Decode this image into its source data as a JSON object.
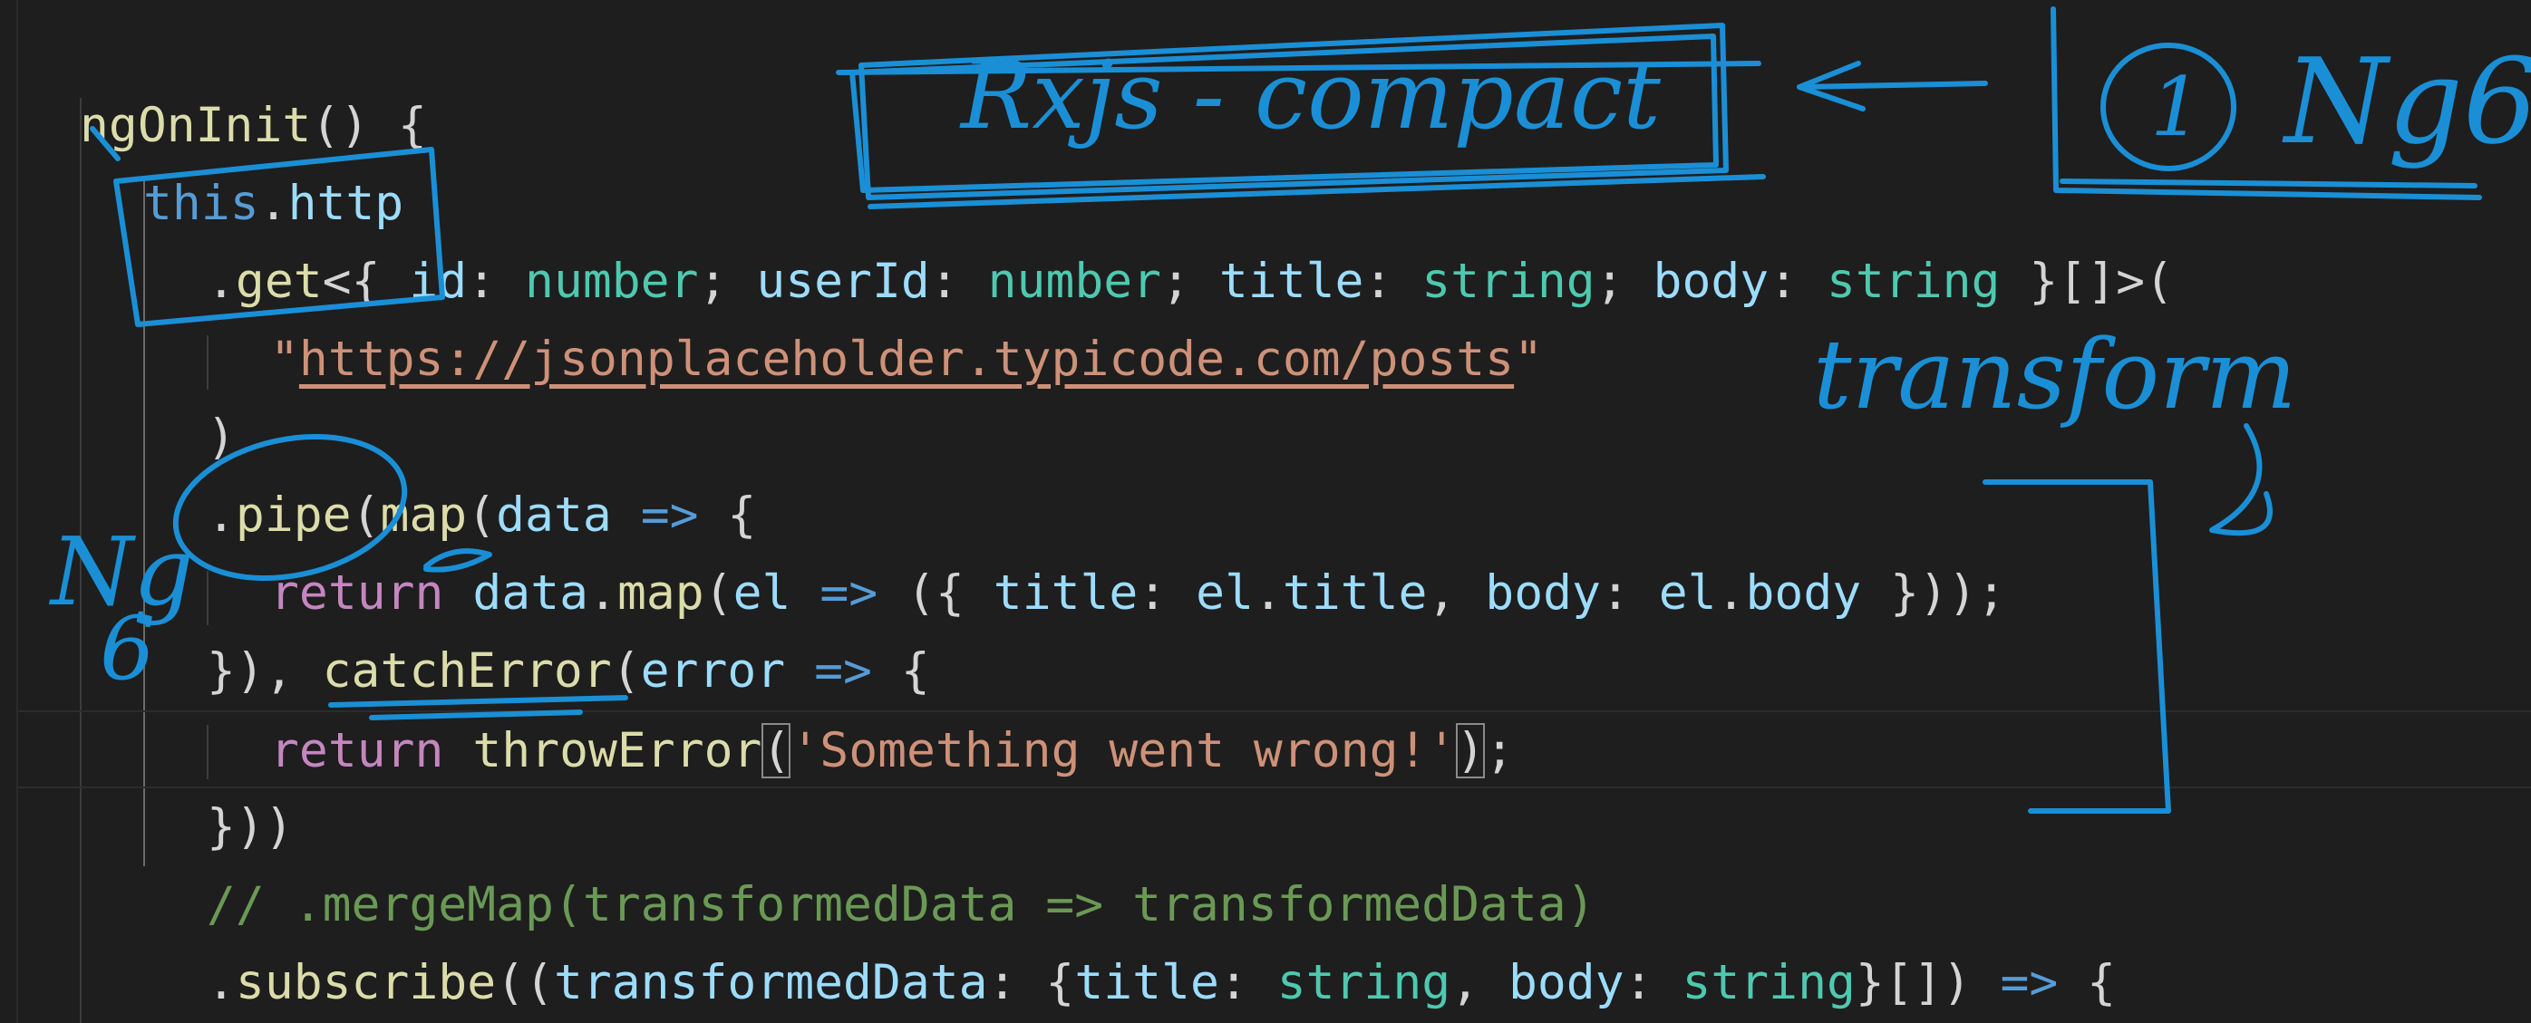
{
  "code": {
    "line1": {
      "fn": "ngOnInit",
      "rest": "() {"
    },
    "line2": {
      "kw": "this",
      "dot": ".",
      "prop": "http"
    },
    "line3": {
      "dot": ".",
      "fn": "get",
      "open": "<{ ",
      "k1": "id",
      "c1": ": ",
      "t1": "number",
      "s1": "; ",
      "k2": "userId",
      "c2": ": ",
      "t2": "number",
      "s2": "; ",
      "k3": "title",
      "c3": ": ",
      "t3": "string",
      "s3": "; ",
      "k4": "body",
      "c4": ": ",
      "t4": "string",
      "close": " }[]>("
    },
    "line4": {
      "q1": "\"",
      "url": "https://jsonplaceholder.typicode.com/posts",
      "q2": "\""
    },
    "line5": {
      "text": ")"
    },
    "line6": {
      "dot": ".",
      "fn1": "pipe",
      "p1": "(",
      "fn2": "map",
      "p2": "(",
      "param": "data",
      "arrow": " => ",
      "brace": "{"
    },
    "line7": {
      "kw": "return",
      "sp": " ",
      "obj": "data",
      "dot": ".",
      "fn": "map",
      "p1": "(",
      "param": "el",
      "arrow": " => ",
      "p2": "({ ",
      "k1": "title",
      "c1": ": ",
      "v1a": "el",
      "d1": ".",
      "v1b": "title",
      "cm": ", ",
      "k2": "body",
      "c2": ": ",
      "v2a": "el",
      "d2": ".",
      "v2b": "body",
      "end": " }));"
    },
    "line8": {
      "a": "}), ",
      "fn": "catchError",
      "p1": "(",
      "param": "error",
      "arrow": " => ",
      "brace": "{"
    },
    "line9": {
      "kw": "return",
      "sp": " ",
      "fn": "throwError",
      "open": "(",
      "str": "'Something went wrong!'",
      "close": ")",
      "semi": ";"
    },
    "line10": {
      "text": "}))"
    },
    "line11": {
      "comment": "// .mergeMap(transformedData => transformedData)"
    },
    "line12": {
      "dot": ".",
      "fn": "subscribe",
      "p1": "((",
      "param": "transformedData",
      "c1": ": {",
      "k1": "title",
      "c2": ": ",
      "t1": "string",
      "cm": ", ",
      "k2": "body",
      "c3": ": ",
      "t2": "string",
      "end": "}[]) ",
      "arrow": "=>",
      "brace": " {"
    }
  },
  "annotations": {
    "rxjs_label": "Rxjs - compact",
    "circle_number": "1",
    "ng6_top": "Ng6",
    "transform_word": "transform",
    "ng6_side": "Ng",
    "ng6_side_digit": "6"
  },
  "colors": {
    "background": "#1e1e1e",
    "ink": "#1a8fd6",
    "function": "#dcdcaa",
    "keyword": "#569cd6",
    "property": "#9cdcfe",
    "type": "#4ec9b0",
    "string": "#ce9178",
    "control": "#c586c0",
    "comment": "#6a9955"
  }
}
